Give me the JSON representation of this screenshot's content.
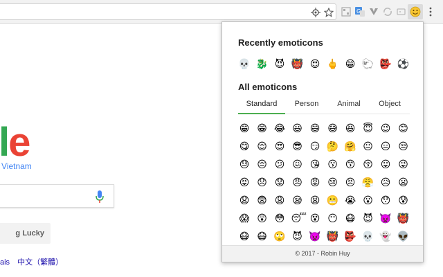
{
  "page": {
    "google_country": "Vietnam",
    "lucky_label": "g Lucky",
    "languages": [
      "ais",
      "中文（繁體）"
    ]
  },
  "popup": {
    "recent_title": "Recently emoticons",
    "all_title": "All emoticons",
    "tabs": [
      {
        "label": "Standard",
        "active": true
      },
      {
        "label": "Person",
        "active": false
      },
      {
        "label": "Animal",
        "active": false
      },
      {
        "label": "Object",
        "active": false
      }
    ],
    "recent": [
      "💀",
      "🐉",
      "😈",
      "👹",
      "😍",
      "🖕",
      "😁",
      "🐑",
      "👺",
      "⚽"
    ],
    "rows": [
      [
        "😁",
        "😁",
        "😂",
        "😃",
        "😄",
        "😅",
        "😆",
        "😇",
        "😉",
        "😊"
      ],
      [
        "😋",
        "😌",
        "😍",
        "😎",
        "😏",
        "🤔",
        "🤗",
        "😐",
        "😑",
        "😒"
      ],
      [
        "😓",
        "😔",
        "😕",
        "😖",
        "😘",
        "😗",
        "😙",
        "😚",
        "😛",
        "😜"
      ],
      [
        "😝",
        "😞",
        "😟",
        "😠",
        "😡",
        "😢",
        "😣",
        "😤",
        "😥",
        "😦"
      ],
      [
        "😧",
        "😨",
        "😩",
        "😪",
        "😫",
        "😬",
        "😭",
        "😮",
        "😯",
        "😰"
      ],
      [
        "😱",
        "😲",
        "😳",
        "😴",
        "😵",
        "😶",
        "😷",
        "😈",
        "👿",
        "👹"
      ],
      [
        "😷",
        "😷",
        "🙄",
        "😈",
        "👿",
        "👹",
        "👺",
        "💀",
        "👻",
        "👽"
      ]
    ],
    "footer": "© 2017 - Robin Huy"
  },
  "colors": {
    "tab_active": "#4caf50",
    "link": "#1a0dab",
    "google_blue": "#4285f4"
  }
}
